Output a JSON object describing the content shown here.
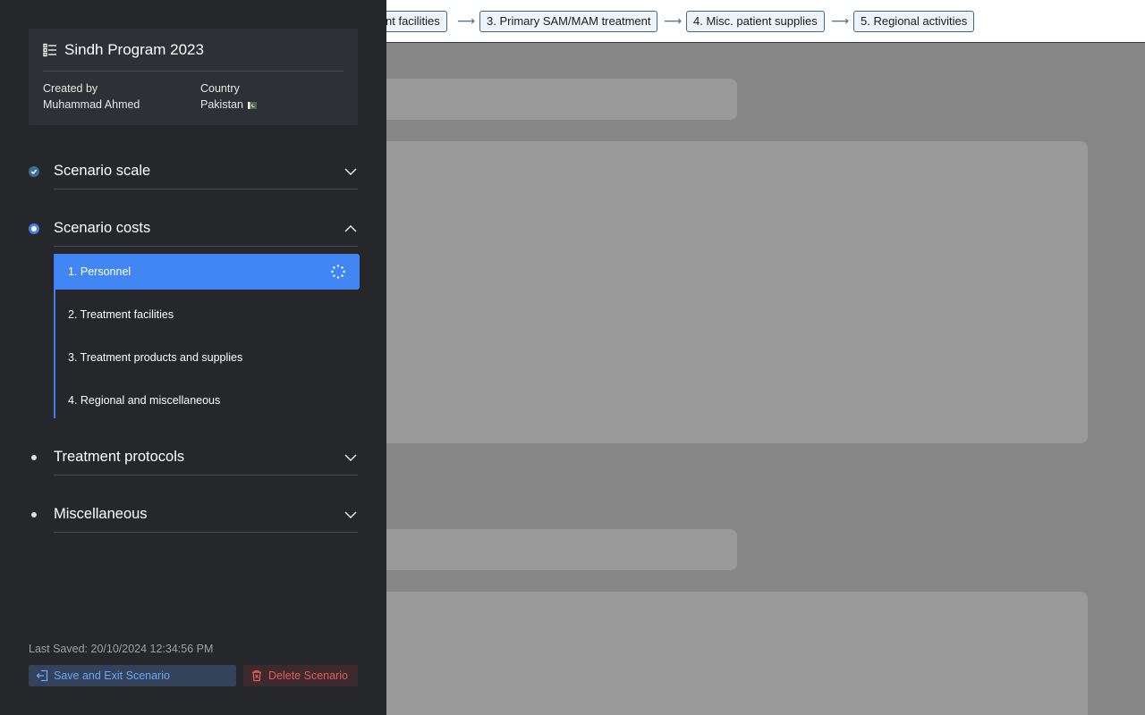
{
  "topbar": {
    "steps": [
      "nt facilities",
      "3. Primary SAM/MAM treatment",
      "4. Misc. patient supplies",
      "5. Regional activities"
    ],
    "arrow": "⟶"
  },
  "scenario": {
    "title": "Sindh Program 2023",
    "created_by_label": "Created by",
    "created_by_value": "Muhammad Ahmed",
    "country_label": "Country",
    "country_value": "Pakistan"
  },
  "sections": {
    "scale": "Scenario scale",
    "costs": "Scenario costs",
    "protocols": "Treatment protocols",
    "misc": "Miscellaneous"
  },
  "cost_items": [
    "1. Personnel",
    "2. Treatment facilities",
    "3. Treatment products and supplies",
    "4. Regional and miscellaneous"
  ],
  "footer": {
    "last_saved": "Last Saved: 20/10/2024 12:34:56 PM",
    "save_label": "Save and Exit Scenario",
    "delete_label": "Delete Scenario"
  },
  "colors": {
    "accent": "#4286f4",
    "sidebar_bg": "#26272b",
    "danger": "#e15d5d"
  }
}
